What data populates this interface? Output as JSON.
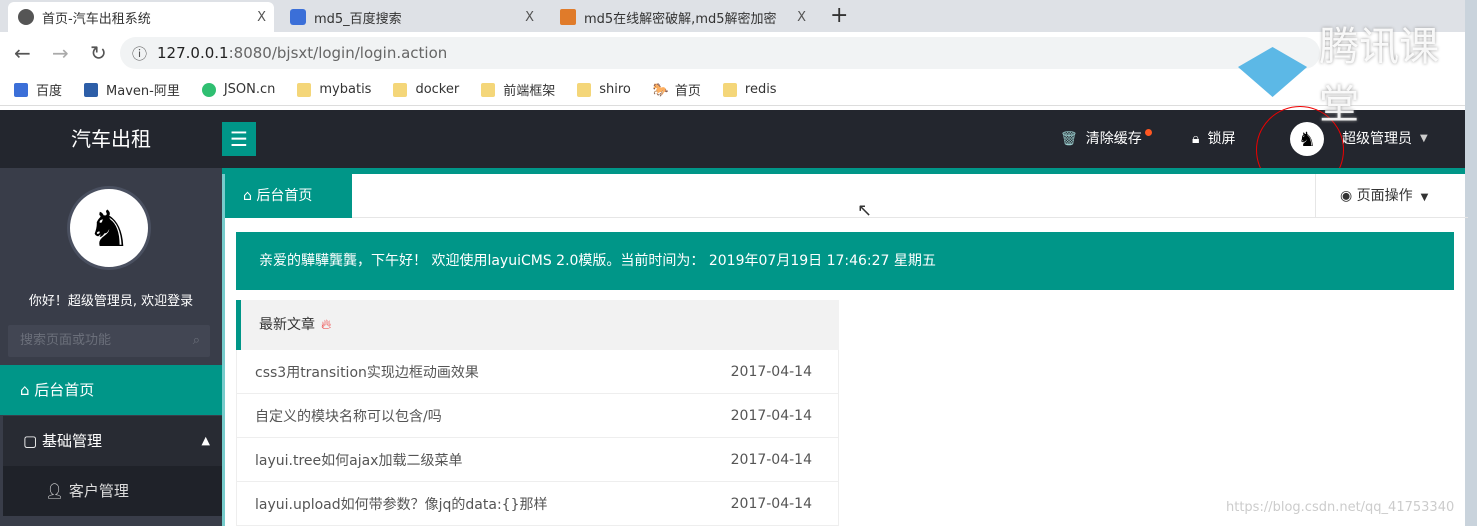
{
  "browser": {
    "tabs": [
      {
        "title": "首页-汽车出租系统",
        "active": true
      },
      {
        "title": "md5_百度搜索"
      },
      {
        "title": "md5在线解密破解,md5解密加密"
      }
    ],
    "close_glyph": "X",
    "new_tab": "+",
    "url_host": "127.0.0.1",
    "url_rest": ":8080/bjsxt/login/login.action",
    "bookmarks": [
      "百度",
      "Maven-阿里",
      "JSON.cn",
      "mybatis",
      "docker",
      "前端框架",
      "shiro",
      "首页",
      "redis"
    ]
  },
  "watermark": {
    "text": "腾讯课堂",
    "csdn": "https://blog.csdn.net/qq_41753340"
  },
  "header": {
    "brand": "汽车出租",
    "clear_cache": "清除缓存",
    "lock": "锁屏",
    "user": "超级管理员",
    "accent": "#009688"
  },
  "sidebar": {
    "greeting": "你好！超级管理员, 欢迎登录",
    "search_placeholder": "搜索页面或功能",
    "items": [
      {
        "label": "后台首页"
      },
      {
        "label": "基础管理"
      },
      {
        "label": "客户管理"
      }
    ]
  },
  "main": {
    "tab": "后台首页",
    "page_ops": "页面操作",
    "banner": "亲爱的驊驊龔龔，下午好！ 欢迎使用layuiCMS 2.0模版。当前时间为： 2019年07月19日 17:46:27  星期五",
    "articles_title": "最新文章",
    "articles": [
      {
        "title": "css3用transition实现边框动画效果",
        "date": "2017-04-14"
      },
      {
        "title": "自定义的模块名称可以包含/吗",
        "date": "2017-04-14"
      },
      {
        "title": "layui.tree如何ajax加载二级菜单",
        "date": "2017-04-14"
      },
      {
        "title": "layui.upload如何带参数？像jq的data:{}那样",
        "date": "2017-04-14"
      }
    ]
  }
}
